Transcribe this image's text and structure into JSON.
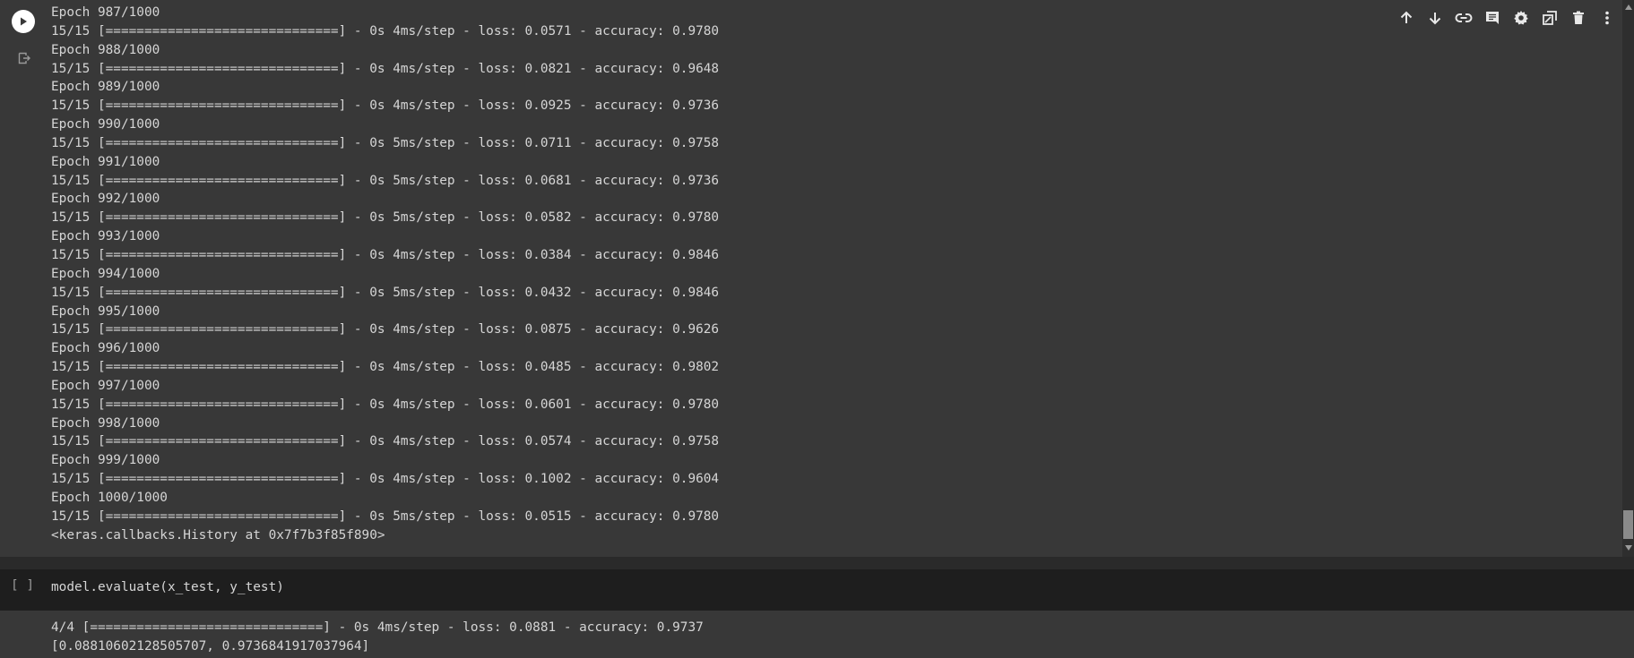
{
  "toolbar": {
    "icons": [
      "arrow-up-icon",
      "arrow-down-icon",
      "link-icon",
      "comment-icon",
      "gear-icon",
      "mirror-icon",
      "trash-icon",
      "more-vert-icon"
    ]
  },
  "output": {
    "lines": [
      "Epoch 987/1000",
      "15/15 [==============================] - 0s 4ms/step - loss: 0.0571 - accuracy: 0.9780",
      "Epoch 988/1000",
      "15/15 [==============================] - 0s 4ms/step - loss: 0.0821 - accuracy: 0.9648",
      "Epoch 989/1000",
      "15/15 [==============================] - 0s 4ms/step - loss: 0.0925 - accuracy: 0.9736",
      "Epoch 990/1000",
      "15/15 [==============================] - 0s 5ms/step - loss: 0.0711 - accuracy: 0.9758",
      "Epoch 991/1000",
      "15/15 [==============================] - 0s 5ms/step - loss: 0.0681 - accuracy: 0.9736",
      "Epoch 992/1000",
      "15/15 [==============================] - 0s 5ms/step - loss: 0.0582 - accuracy: 0.9780",
      "Epoch 993/1000",
      "15/15 [==============================] - 0s 4ms/step - loss: 0.0384 - accuracy: 0.9846",
      "Epoch 994/1000",
      "15/15 [==============================] - 0s 5ms/step - loss: 0.0432 - accuracy: 0.9846",
      "Epoch 995/1000",
      "15/15 [==============================] - 0s 4ms/step - loss: 0.0875 - accuracy: 0.9626",
      "Epoch 996/1000",
      "15/15 [==============================] - 0s 4ms/step - loss: 0.0485 - accuracy: 0.9802",
      "Epoch 997/1000",
      "15/15 [==============================] - 0s 4ms/step - loss: 0.0601 - accuracy: 0.9780",
      "Epoch 998/1000",
      "15/15 [==============================] - 0s 4ms/step - loss: 0.0574 - accuracy: 0.9758",
      "Epoch 999/1000",
      "15/15 [==============================] - 0s 4ms/step - loss: 0.1002 - accuracy: 0.9604",
      "Epoch 1000/1000",
      "15/15 [==============================] - 0s 5ms/step - loss: 0.0515 - accuracy: 0.9780",
      "<keras.callbacks.History at 0x7f7b3f85f890>"
    ]
  },
  "code_cell": {
    "exec_count": "[ ]",
    "code": "model.evaluate(x_test, y_test)",
    "output_lines": [
      "4/4 [==============================] - 0s 4ms/step - loss: 0.0881 - accuracy: 0.9737",
      "[0.08810602128505707, 0.9736841917037964]"
    ]
  },
  "colors": {
    "background": "#383838",
    "editor_background": "#1e1e1e",
    "text": "#d5d5d5",
    "icon": "#e8e8e8"
  }
}
